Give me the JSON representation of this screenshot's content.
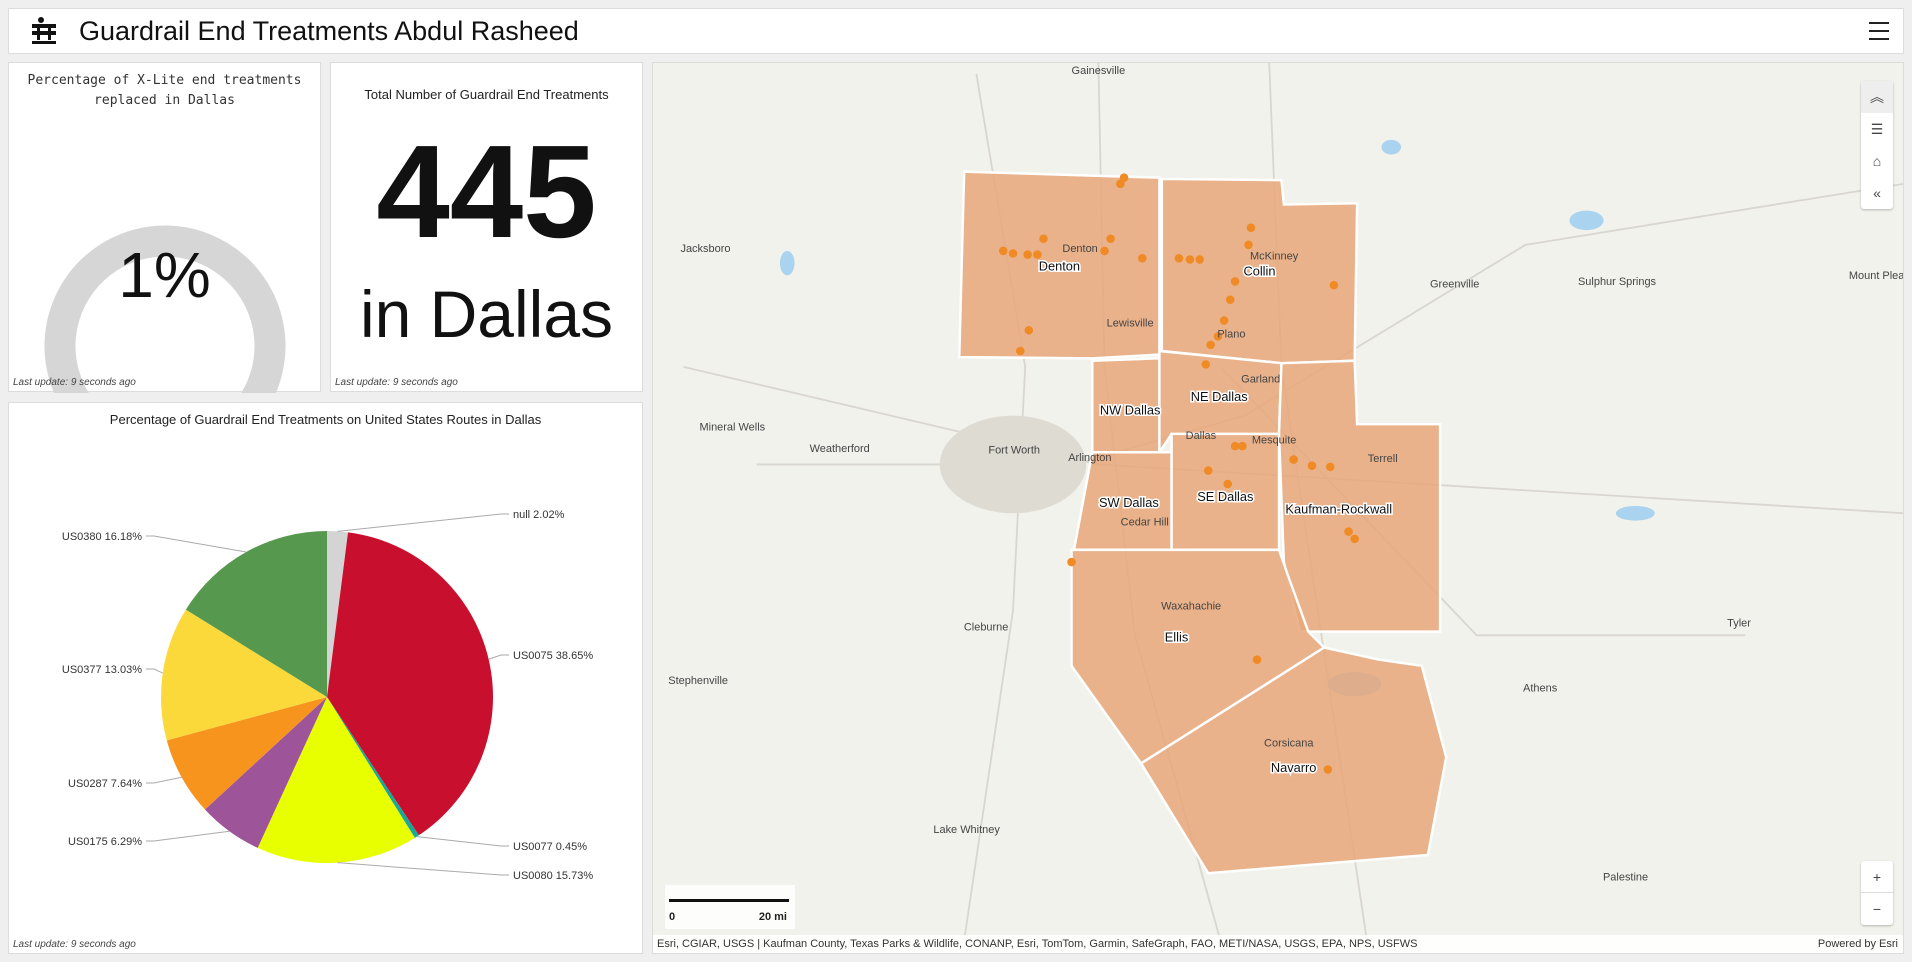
{
  "header": {
    "title": "Guardrail End Treatments Abdul Rasheed",
    "logo_icon": "guardrail-icon",
    "menu_icon": "hamburger-menu-icon"
  },
  "gauge": {
    "title": "Percentage of X-Lite end treatments replaced in Dallas",
    "value_label": "1%",
    "value_percent": 1,
    "fill_color": "#1f9bc7",
    "track_color": "#d6d6d6",
    "last_update": "Last update: 9 seconds ago"
  },
  "indicator": {
    "title": "Total Number of Guardrail End Treatments",
    "value": "445",
    "suffix": "in Dallas",
    "last_update": "Last update: 9 seconds ago"
  },
  "chart_data": {
    "type": "pie",
    "title": "Percentage of Guardrail End Treatments on United States Routes in Dallas",
    "categories": [
      "null",
      "US0075",
      "US0077",
      "US0080",
      "US0175",
      "US0287",
      "US0377",
      "US0380"
    ],
    "values": [
      2.02,
      38.65,
      0.45,
      15.73,
      6.29,
      7.64,
      13.03,
      16.18
    ],
    "labels": [
      "null 2.02%",
      "US0075 38.65%",
      "US0077 0.45%",
      "US0080 15.73%",
      "US0175 6.29%",
      "US0287 7.64%",
      "US0377 13.03%",
      "US0380 16.18%"
    ],
    "colors": [
      "#d4d4d4",
      "#c8102e",
      "#17a89a",
      "#e8ff00",
      "#9e5499",
      "#f7941d",
      "#fcd93b",
      "#56994e"
    ]
  },
  "pie": {
    "last_update": "Last update: 9 seconds ago"
  },
  "map": {
    "districts": [
      "Denton",
      "Collin",
      "NW Dallas",
      "NE Dallas",
      "SW Dallas",
      "SE Dallas",
      "Kaufman-Rockwall",
      "Ellis",
      "Navarro"
    ],
    "district_fill": "#e8a77a",
    "point_color": "#f08a24",
    "places": [
      "Gainesville",
      "Jacksboro",
      "Greenville",
      "Sulphur Springs",
      "Mount Pleas",
      "Mineral Wells",
      "Weatherford",
      "Fort Worth",
      "Arlington",
      "Terrell",
      "Cleburne",
      "Tyler",
      "Stephenville",
      "Athens",
      "Corsicana",
      "Lake Whitney",
      "Palestine",
      "Waxahachie",
      "Cedar Hill",
      "Lewisville",
      "Plano",
      "McKinney",
      "Garland",
      "Dallas",
      "Mesquite",
      "Denton"
    ],
    "controls": {
      "collapse_icon": "chevron-double-up-icon",
      "legend_icon": "legend-list-icon",
      "home_icon": "home-icon",
      "expand_icon": "chevron-double-left-icon",
      "zoom_in": "+",
      "zoom_out": "−"
    },
    "scale": {
      "start": "0",
      "end": "20 mi"
    },
    "attribution": "Esri, CGIAR, USGS | Kaufman County, Texas Parks & Wildlife, CONANP, Esri, TomTom, Garmin, SafeGraph, FAO, METI/NASA, USGS, EPA, NPS, USFWS",
    "powered_by": "Powered by Esri"
  }
}
